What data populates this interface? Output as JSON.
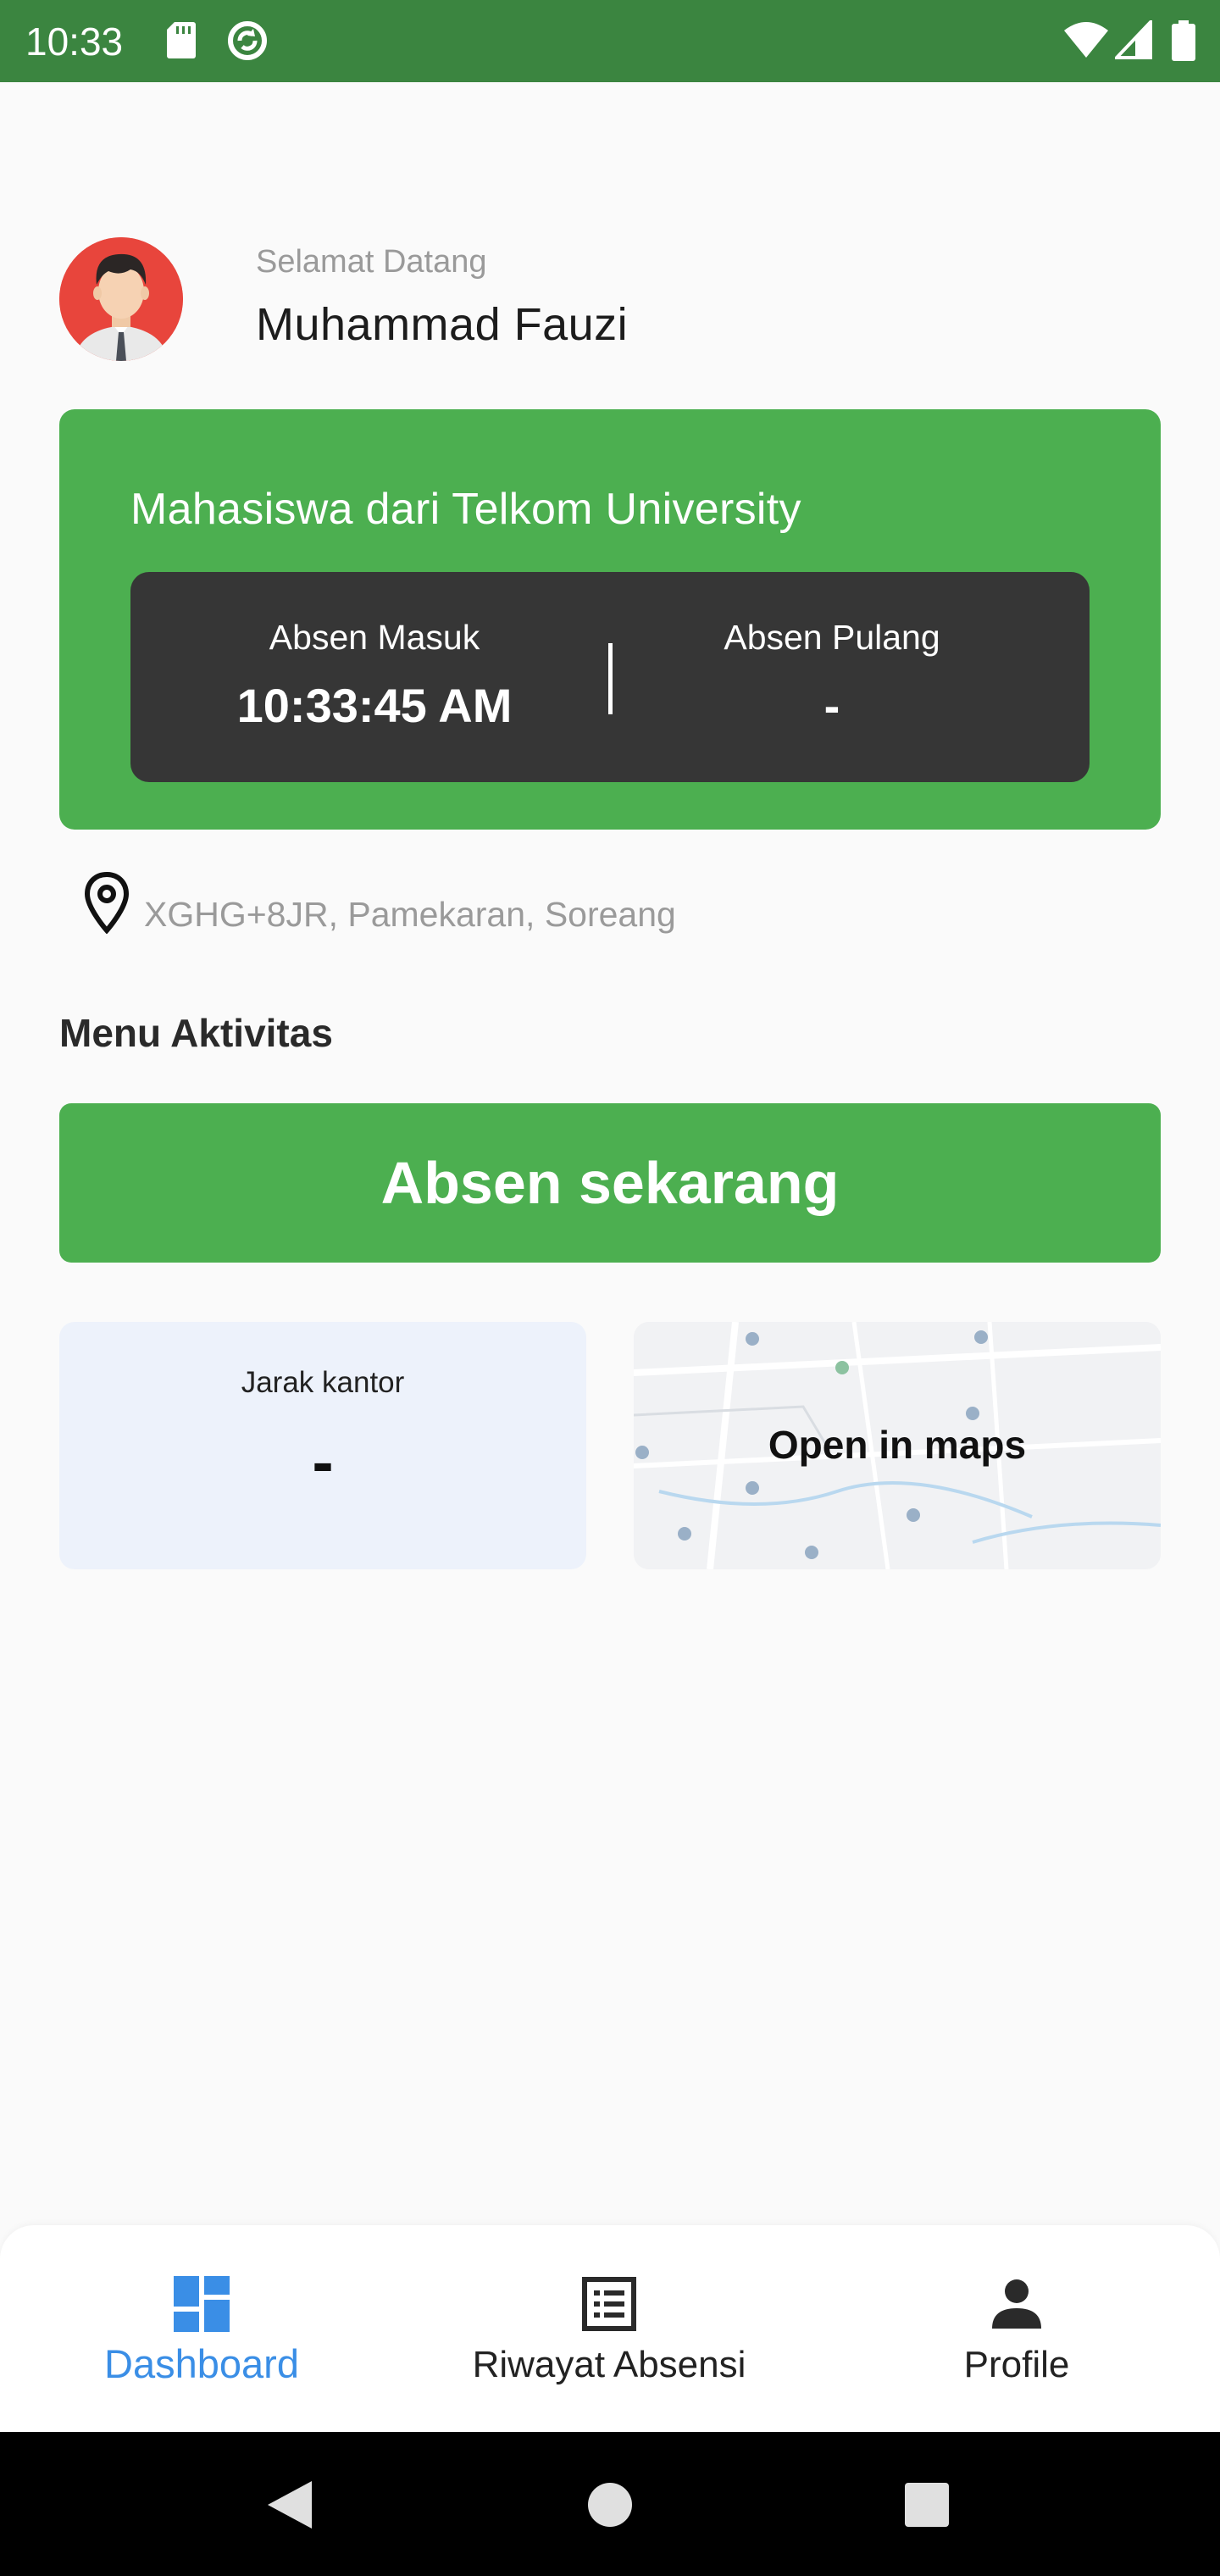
{
  "status_bar": {
    "time": "10:33",
    "icons": [
      "sd-card-icon",
      "sync-icon",
      "wifi-icon",
      "signal-icon",
      "battery-icon"
    ],
    "background": "#3b8540"
  },
  "header": {
    "greeting": "Selamat Datang",
    "user_name": "Muhammad Fauzi"
  },
  "status_card": {
    "title": "Mahasiswa dari Telkom University",
    "check_in_label": "Absen Masuk",
    "check_in_value": "10:33:45 AM",
    "check_out_label": "Absen Pulang",
    "check_out_value": "-",
    "background": "#4caf50"
  },
  "location": {
    "address": "XGHG+8JR, Pamekaran, Soreang"
  },
  "menu": {
    "title": "Menu Aktivitas",
    "absen_button": "Absen sekarang",
    "distance_label": "Jarak kantor",
    "distance_value": "-",
    "maps_label": "Open in maps"
  },
  "bottom_nav": {
    "items": [
      {
        "label": "Dashboard",
        "icon": "dashboard-icon",
        "active": true
      },
      {
        "label": "Riwayat Absensi",
        "icon": "list-icon",
        "active": false
      },
      {
        "label": "Profile",
        "icon": "person-icon",
        "active": false
      }
    ],
    "active_color": "#3a8ee6"
  },
  "system_nav": {
    "icons": [
      "back-icon",
      "home-icon",
      "recents-icon"
    ]
  }
}
